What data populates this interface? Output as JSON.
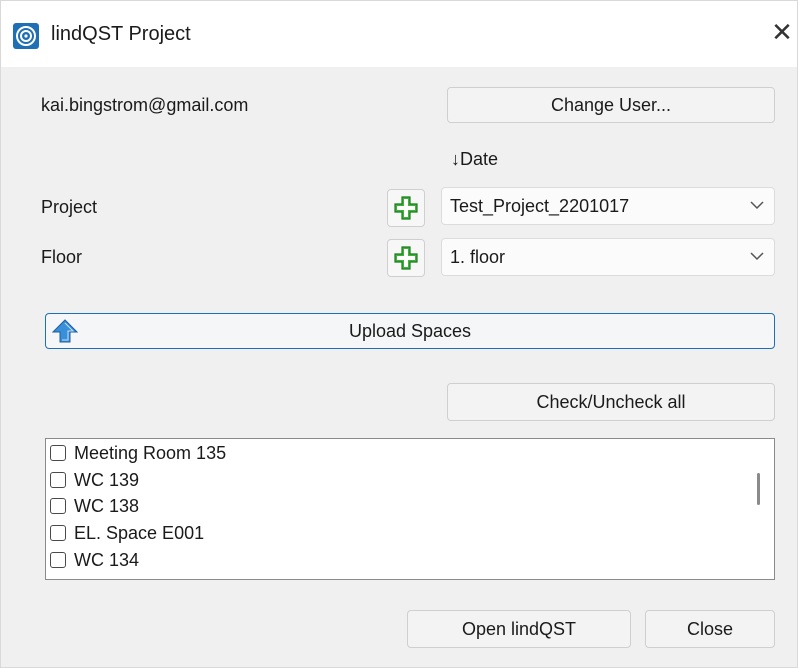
{
  "window": {
    "title": "lindQST Project",
    "close_icon": "close-icon"
  },
  "user": {
    "email": "kai.bingstrom@gmail.com",
    "change_user_label": "Change User..."
  },
  "sort": {
    "label": "↓Date"
  },
  "project": {
    "label": "Project",
    "value": "Test_Project_2201017"
  },
  "floor": {
    "label": "Floor",
    "value": "1. floor"
  },
  "upload": {
    "label": "Upload Spaces"
  },
  "check_all": {
    "label": "Check/Uncheck all"
  },
  "spaces": [
    {
      "label": "Meeting Room 135",
      "checked": false
    },
    {
      "label": "WC 139",
      "checked": false
    },
    {
      "label": "WC 138",
      "checked": false
    },
    {
      "label": "EL. Space E001",
      "checked": false
    },
    {
      "label": "WC 134",
      "checked": false
    }
  ],
  "footer": {
    "open_label": "Open lindQST",
    "close_label": "Close"
  },
  "colors": {
    "accent": "#1f6fb5",
    "plus_green": "#3cb43c",
    "arrow_blue": "#3a8fd9"
  }
}
